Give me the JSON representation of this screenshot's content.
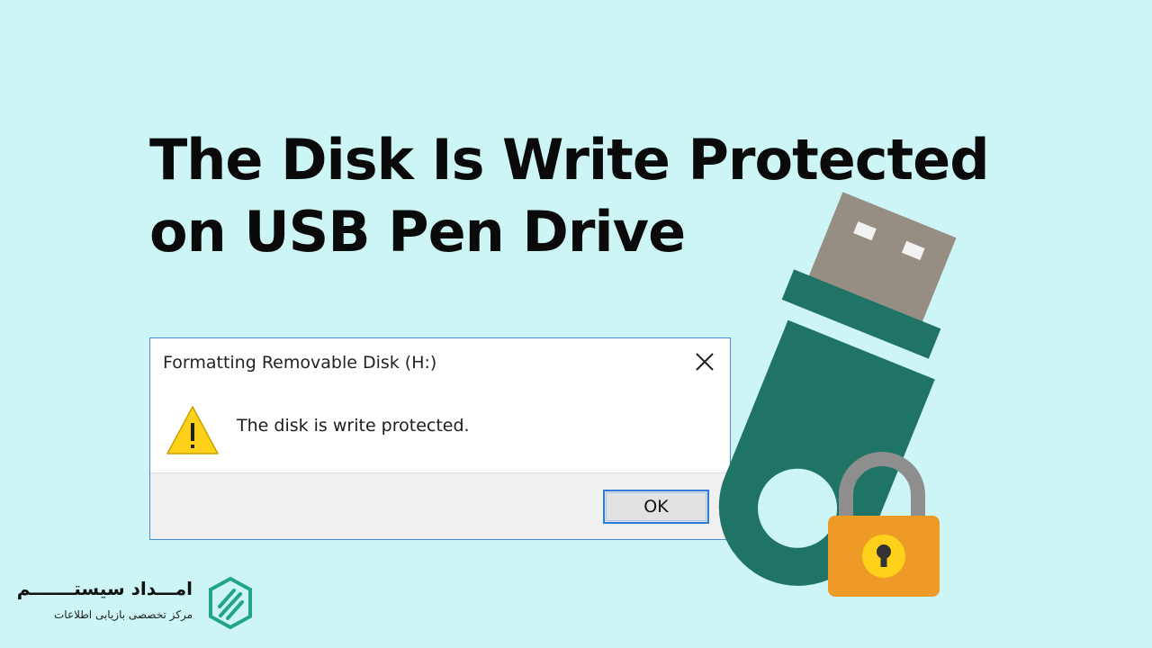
{
  "headline": {
    "line1": "The Disk Is Write Protected",
    "line2": "on USB Pen Drive"
  },
  "dialog": {
    "title": "Formatting Removable Disk (H:)",
    "message": "The disk is write protected.",
    "ok_label": "OK",
    "close_icon": "close-x-icon",
    "warning_icon": "warning-triangle-icon"
  },
  "illustration": {
    "usb_icon": "usb-flash-drive-icon",
    "lock_icon": "padlock-icon"
  },
  "brand": {
    "name": "امـــداد سیستـــــــم",
    "tagline": "مرکز تخصصی بازیابی اطلاعات",
    "logo_icon": "brand-logo-icon"
  },
  "colors": {
    "background": "#cdf5f5",
    "usb_body": "#1f7466",
    "usb_connector": "#968d83",
    "lock_body": "#ee9a26",
    "lock_shackle": "#8e8e8e",
    "brand_logo": "#22a587",
    "dialog_border": "#4a8ad8",
    "warning_fill": "#ffd11a"
  }
}
